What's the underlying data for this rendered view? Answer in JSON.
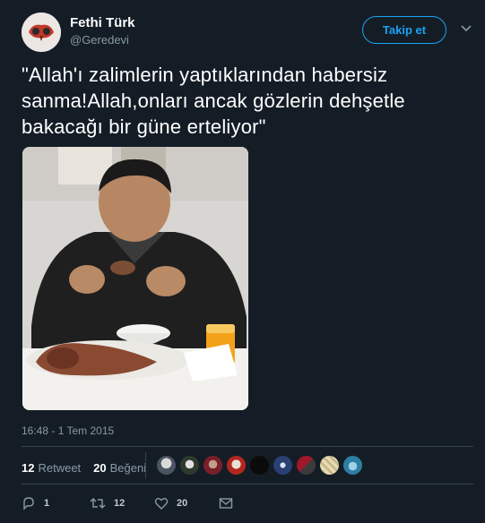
{
  "user": {
    "name": "Fethi Türk",
    "handle": "@Geredevi"
  },
  "follow_button": {
    "label": "Takip et"
  },
  "tweet": {
    "text": "\"Allah'ı zalimlerin yaptıklarından habersiz sanma!Allah,onları ancak gözlerin dehşetle bakacağı bir güne erteliyor\"",
    "timestamp": "16:48 - 1 Tem 2015"
  },
  "stats": {
    "retweets_count": "12",
    "retweets_label": "Retweet",
    "likes_count": "20",
    "likes_label": "Beğeni"
  },
  "actions": {
    "reply_count": "1",
    "retweet_count": "12",
    "like_count": "20"
  },
  "colors": {
    "background": "#141d26",
    "accent": "#1da1f2",
    "muted": "#8899a6",
    "divider": "#38444d"
  },
  "icons": [
    "chevron-down-icon",
    "reply-icon",
    "retweet-icon",
    "like-icon",
    "message-icon"
  ]
}
